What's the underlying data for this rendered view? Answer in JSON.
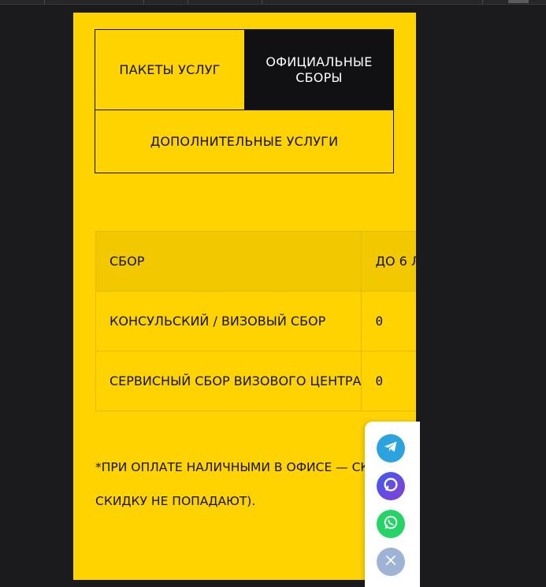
{
  "tabs": {
    "packages": "ПАКЕТЫ УСЛУГ",
    "fees_line1": "ОФИЦИАЛЬНЫЕ",
    "fees_line2": "СБОРЫ",
    "extra": "ДОПОЛНИТЕЛЬНЫЕ УСЛУГИ"
  },
  "table": {
    "headers": [
      "СБОР",
      "ДО 6 Л"
    ],
    "rows": [
      {
        "name": "КОНСУЛЬСКИЙ / ВИЗОВЫЙ СБОР",
        "value": "0"
      },
      {
        "name": "СЕРВИСНЫЙ СБОР ВИЗОВОГО ЦЕНТРА",
        "value": "0"
      }
    ]
  },
  "note": {
    "line1": "*ПРИ ОПЛАТЕ НАЛИЧНЫМИ В ОФИСЕ — СКИ",
    "line2": "СКИДКУ НЕ ПОПАДАЮТ)."
  },
  "messenger": {
    "icons": [
      "telegram-icon",
      "max-messenger-icon",
      "whatsapp-icon",
      "close-icon"
    ],
    "colors": {
      "telegram": "#2aa3df",
      "whatsapp": "#25d366",
      "close": "#9fb3d6"
    }
  },
  "colors": {
    "accent": "#ffd300",
    "dark": "#111113",
    "page_bg": "#1b1b1d"
  }
}
